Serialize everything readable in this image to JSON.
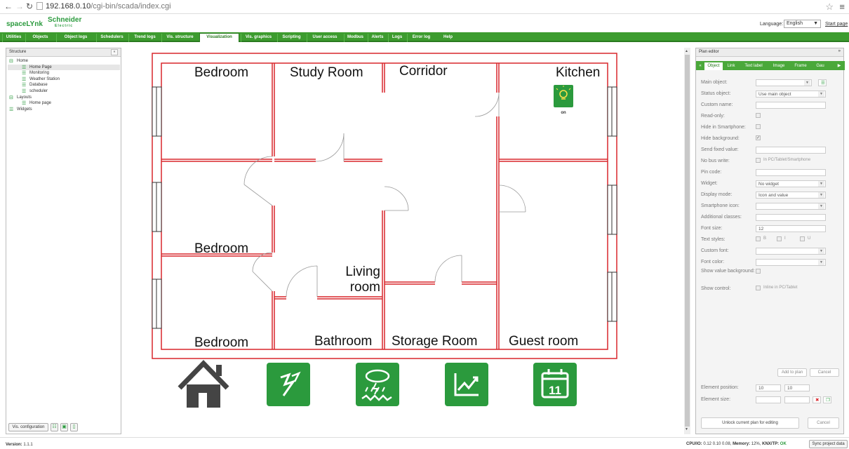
{
  "browser": {
    "url_host": "192.168.0.10",
    "url_path": "/cgi-bin/scada/index.cgi"
  },
  "app": {
    "brand": "spaceLYnk",
    "vendor": "Schneider",
    "vendor_sub": "Electric",
    "language_label": "Language:",
    "language_value": "English",
    "start_page": "Start page"
  },
  "tabs": [
    "Utilities",
    "Objects",
    "Object logs",
    "Schedulers",
    "Trend logs",
    "Vis. structure",
    "Visualization",
    "Vis. graphics",
    "Scripting",
    "User access",
    "Modbus",
    "Alerts",
    "Logs",
    "Error log",
    "Help"
  ],
  "active_tab": "Visualization",
  "structure": {
    "title": "Structure",
    "items": [
      {
        "label": "Home",
        "type": "folder"
      },
      {
        "label": "Home Page",
        "type": "page",
        "selected": true
      },
      {
        "label": "Monitoring",
        "type": "page"
      },
      {
        "label": "Weather Station",
        "type": "page"
      },
      {
        "label": "Database",
        "type": "page"
      },
      {
        "label": "scheduler",
        "type": "page"
      },
      {
        "label": "Layouts",
        "type": "folder"
      },
      {
        "label": "Home page",
        "type": "page"
      },
      {
        "label": "Widgets",
        "type": "page"
      }
    ],
    "footer_button": "Vis. configuration"
  },
  "plan": {
    "rooms": [
      "Bedroom",
      "Study Room",
      "Corridor",
      "Kitchen",
      "Bedroom",
      "Living room",
      "Bedroom",
      "Bathroom",
      "Storage Room",
      "Guest room"
    ],
    "lamp_label": "on",
    "lamp_color": "#2b9a3d",
    "wall_color": "#d9262c",
    "nav_icons": [
      "home-icon",
      "energy-icon",
      "weather-icon",
      "trend-icon",
      "calendar-icon"
    ],
    "calendar_day": "11"
  },
  "plan_editor": {
    "title": "Plan editor",
    "tabs": [
      "Object",
      "Link",
      "Text label",
      "Image",
      "Frame",
      "Gau"
    ],
    "active_tab": "Object",
    "fields": {
      "main_object": "Main object:",
      "status_object": "Status object:",
      "status_object_value": "Use main object",
      "custom_name": "Custom name:",
      "read_only": "Read-only:",
      "hide_smartphone": "Hide in Smartphone:",
      "hide_background": "Hide background:",
      "send_fixed": "Send fixed value:",
      "no_bus_write": "No bus write:",
      "no_bus_write_note": "In PC/Tablet/Smartphone",
      "pin_code": "Pin code:",
      "widget": "Widget:",
      "widget_value": "No widget",
      "display_mode": "Display mode:",
      "display_mode_value": "Icon and value",
      "smartphone_icon": "Smartphone icon:",
      "additional_classes": "Additional classes:",
      "font_size": "Font size:",
      "font_size_value": "12",
      "text_styles": "Text styles:",
      "style_b": "B",
      "style_i": "I",
      "style_u": "U",
      "custom_font": "Custom font:",
      "font_color": "Font color:",
      "show_value_bg": "Show value background:",
      "show_control": "Show control:",
      "show_control_note": "Inline in PC/Tablet"
    },
    "add_to_plan": "Add to plan",
    "cancel": "Cancel",
    "element_position": "Element position:",
    "pos_x": "10",
    "pos_y": "10",
    "element_size": "Element size:",
    "unlock": "Unlock current plan for editing",
    "cancel2": "Cancel"
  },
  "status": {
    "version_label": "Version:",
    "version": "1.1.1",
    "cpu_label": "CPU/IO:",
    "cpu": "0.12 0.10 0.08,",
    "mem_label": "Memory:",
    "mem": "12%,",
    "knx_label": "KNX/TP:",
    "knx": "OK",
    "sync": "Sync project data"
  }
}
